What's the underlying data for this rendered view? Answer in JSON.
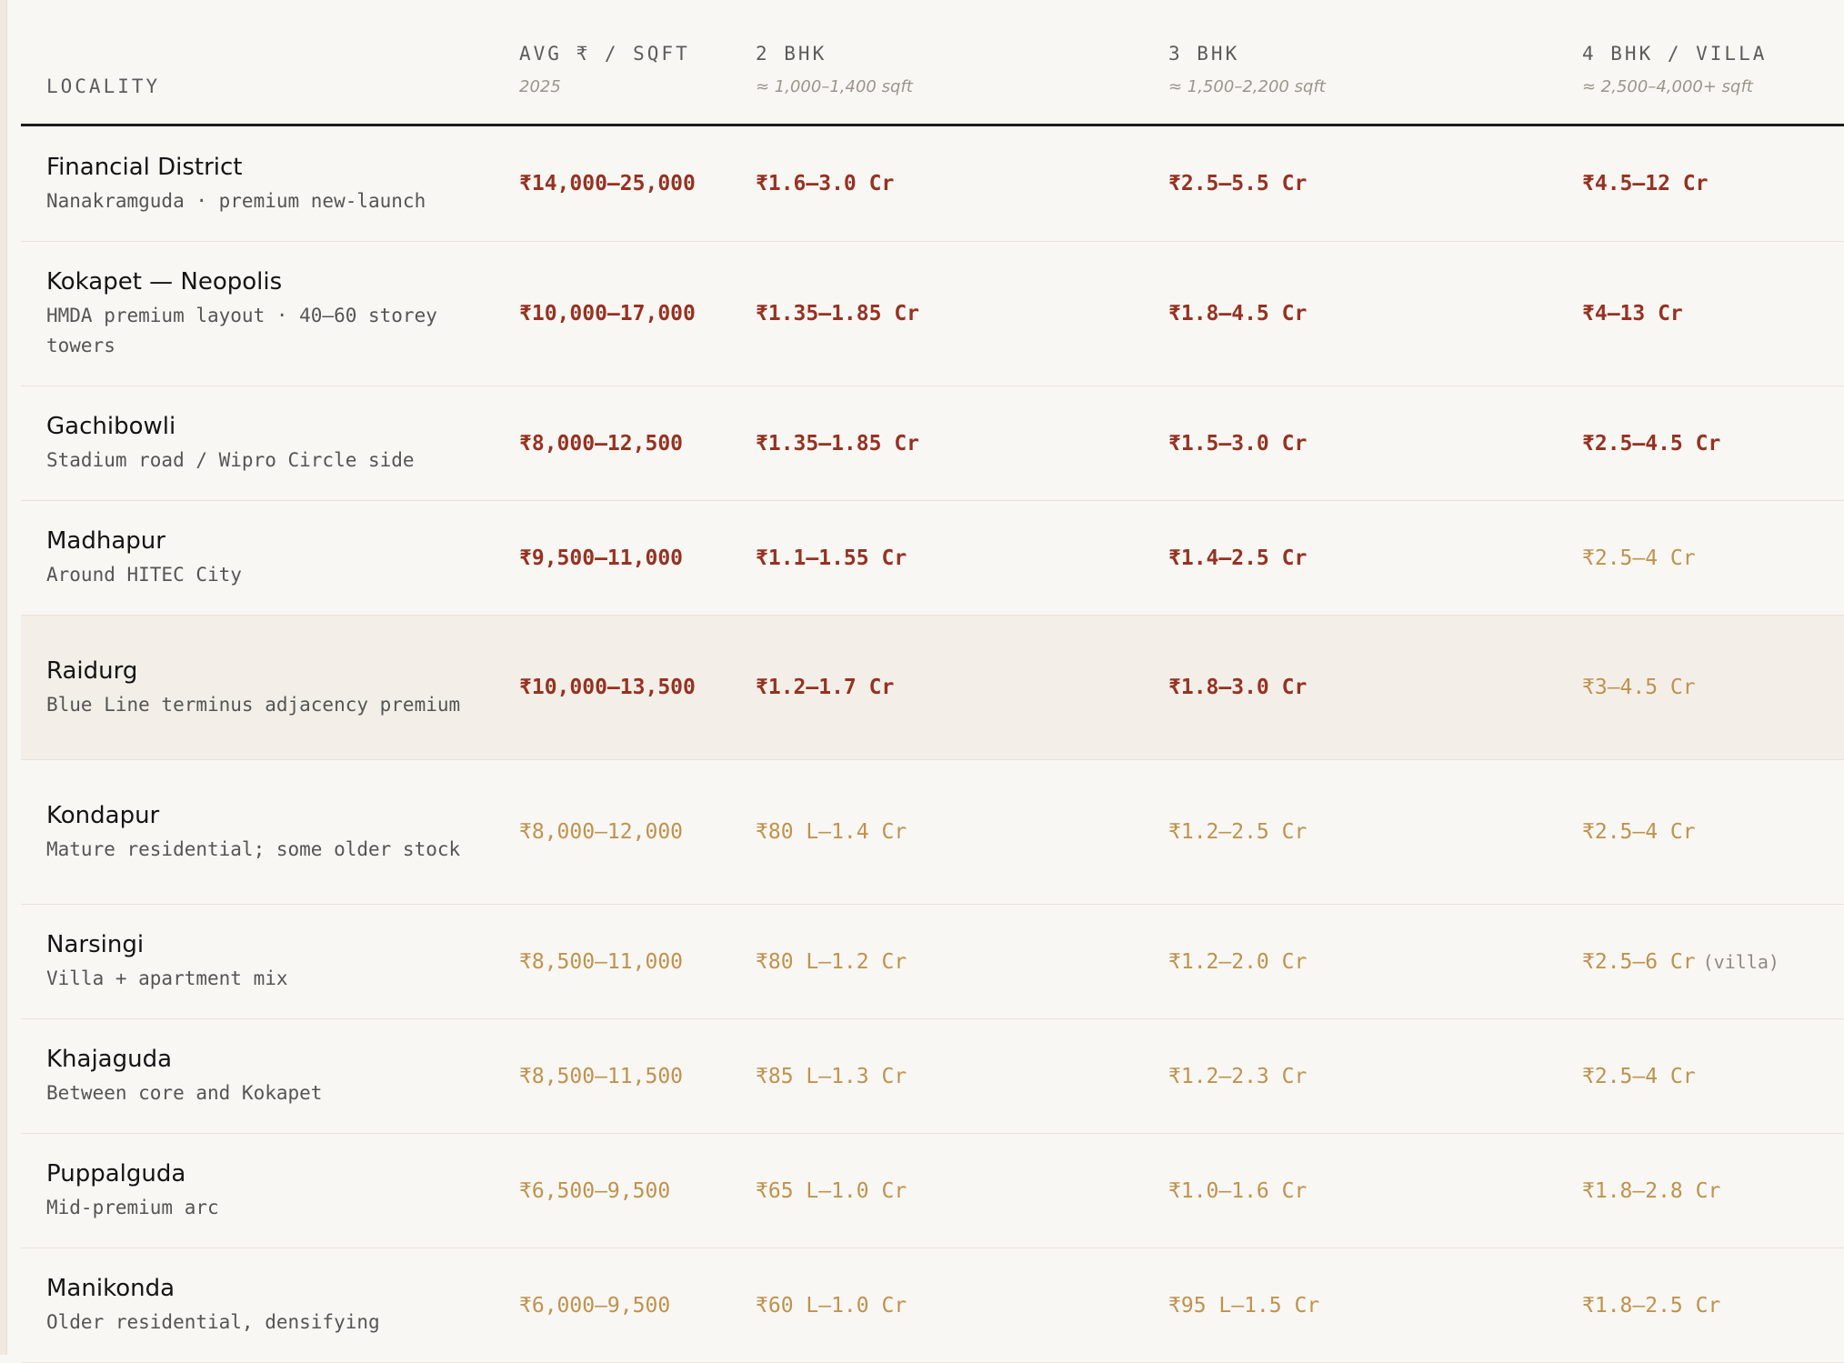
{
  "header": {
    "locality": "LOCALITY",
    "avg_sqft": {
      "title": "AVG ₹ / SQFT",
      "sub": "2025"
    },
    "bhk2": {
      "title": "2 BHK",
      "sub": "≈ 1,000–1,400 sqft"
    },
    "bhk3": {
      "title": "3 BHK",
      "sub": "≈ 1,500–2,200 sqft"
    },
    "bhk4": {
      "title": "4 BHK / VILLA",
      "sub": "≈ 2,500–4,000+ sqft"
    }
  },
  "rows": [
    {
      "name": "Financial District",
      "desc": "Nanakramguda · premium new-launch",
      "sqft": "₹14,000–25,000",
      "bhk2": "₹1.6–3.0 Cr",
      "bhk3": "₹2.5–5.5 Cr",
      "bhk4": "₹4.5–12 Cr",
      "bhk4_note": "",
      "tone": [
        "strong",
        "strong",
        "strong",
        "strong"
      ]
    },
    {
      "name": "Kokapet — Neopolis",
      "desc": "HMDA premium layout · 40–60 storey towers",
      "sqft": "₹10,000–17,000",
      "bhk2": "₹1.35–1.85 Cr",
      "bhk3": "₹1.8–4.5 Cr",
      "bhk4": "₹4–13 Cr",
      "bhk4_note": "",
      "tone": [
        "strong",
        "strong",
        "strong",
        "strong"
      ]
    },
    {
      "name": "Gachibowli",
      "desc": "Stadium road / Wipro Circle side",
      "sqft": "₹8,000–12,500",
      "bhk2": "₹1.35–1.85 Cr",
      "bhk3": "₹1.5–3.0 Cr",
      "bhk4": "₹2.5–4.5 Cr",
      "bhk4_note": "",
      "tone": [
        "strong",
        "strong",
        "strong",
        "strong"
      ]
    },
    {
      "name": "Madhapur",
      "desc": "Around HITEC City",
      "sqft": "₹9,500–11,000",
      "bhk2": "₹1.1–1.55 Cr",
      "bhk3": "₹1.4–2.5 Cr",
      "bhk4": "₹2.5–4 Cr",
      "bhk4_note": "",
      "tone": [
        "strong",
        "strong",
        "strong",
        "soft"
      ]
    },
    {
      "name": "Raidurg",
      "desc": "Blue Line terminus adjacency premium",
      "sqft": "₹10,000–13,500",
      "bhk2": "₹1.2–1.7 Cr",
      "bhk3": "₹1.8–3.0 Cr",
      "bhk4": "₹3–4.5 Cr",
      "bhk4_note": "",
      "tone": [
        "strong",
        "strong",
        "strong",
        "soft"
      ],
      "highlight": true
    },
    {
      "name": "Kondapur",
      "desc": "Mature residential; some older stock",
      "sqft": "₹8,000–12,000",
      "bhk2": "₹80 L–1.4 Cr",
      "bhk3": "₹1.2–2.5 Cr",
      "bhk4": "₹2.5–4 Cr",
      "bhk4_note": "",
      "tone": [
        "soft",
        "soft",
        "soft",
        "soft"
      ]
    },
    {
      "name": "Narsingi",
      "desc": "Villa + apartment mix",
      "sqft": "₹8,500–11,000",
      "bhk2": "₹80 L–1.2 Cr",
      "bhk3": "₹1.2–2.0 Cr",
      "bhk4": "₹2.5–6 Cr",
      "bhk4_note": "(villa)",
      "tone": [
        "soft",
        "soft",
        "soft",
        "soft"
      ]
    },
    {
      "name": "Khajaguda",
      "desc": "Between core and Kokapet",
      "sqft": "₹8,500–11,500",
      "bhk2": "₹85 L–1.3 Cr",
      "bhk3": "₹1.2–2.3 Cr",
      "bhk4": "₹2.5–4 Cr",
      "bhk4_note": "",
      "tone": [
        "soft",
        "soft",
        "soft",
        "soft"
      ]
    },
    {
      "name": "Puppalguda",
      "desc": "Mid-premium arc",
      "sqft": "₹6,500–9,500",
      "bhk2": "₹65 L–1.0 Cr",
      "bhk3": "₹1.0–1.6 Cr",
      "bhk4": "₹1.8–2.8 Cr",
      "bhk4_note": "",
      "tone": [
        "soft",
        "soft",
        "soft",
        "soft"
      ]
    },
    {
      "name": "Manikonda",
      "desc": "Older residential, densifying",
      "sqft": "₹6,000–9,500",
      "bhk2": "₹60 L–1.0 Cr",
      "bhk3": "₹95 L–1.5 Cr",
      "bhk4": "₹1.8–2.5 Cr",
      "bhk4_note": "",
      "tone": [
        "soft",
        "soft",
        "soft",
        "soft"
      ]
    }
  ]
}
